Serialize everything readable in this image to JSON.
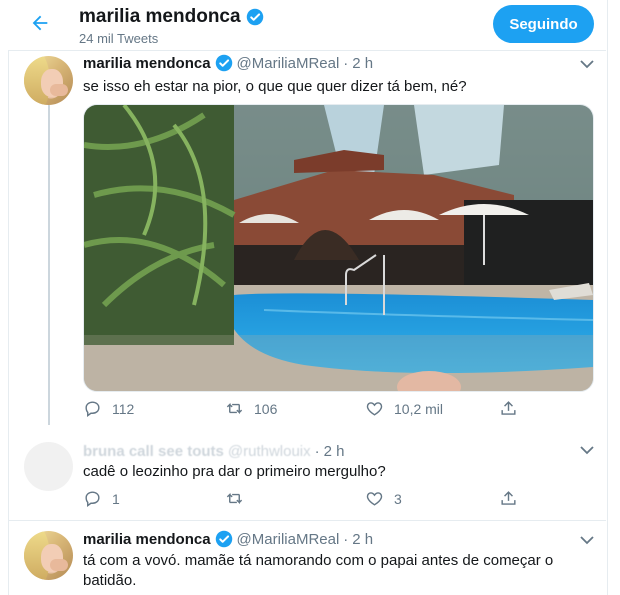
{
  "header": {
    "title": "marilia mendonca",
    "tweet_count": "24 mil Tweets",
    "follow_button": "Seguindo"
  },
  "tweets": [
    {
      "name": "marilia mendonca",
      "handle": "@MariliaMReal",
      "dot": "·",
      "time": "2 h",
      "text": "se isso eh estar na pior, o que que quer dizer tá bem, né?",
      "replies": "112",
      "retweets": "106",
      "likes": "10,2 mil"
    },
    {
      "name": "bruna call see touts",
      "handle": "@ruthwlouix",
      "dot": "·",
      "time": "2 h",
      "text": "cadê o leozinho pra dar o primeiro mergulho?",
      "replies": "1",
      "retweets": "",
      "likes": "3"
    },
    {
      "name": "marilia mendonca",
      "handle": "@MariliaMReal",
      "dot": "·",
      "time": "2 h",
      "text": "tá com a vovó. mamãe tá namorando com o papai antes de começar o batidão."
    }
  ],
  "colors": {
    "accent": "#1da1f2",
    "muted": "#657786",
    "border": "#e6ecf0"
  },
  "icons": [
    "back-arrow-icon",
    "verified-badge-icon",
    "chevron-down-icon",
    "reply-icon",
    "retweet-icon",
    "like-icon",
    "share-icon"
  ]
}
